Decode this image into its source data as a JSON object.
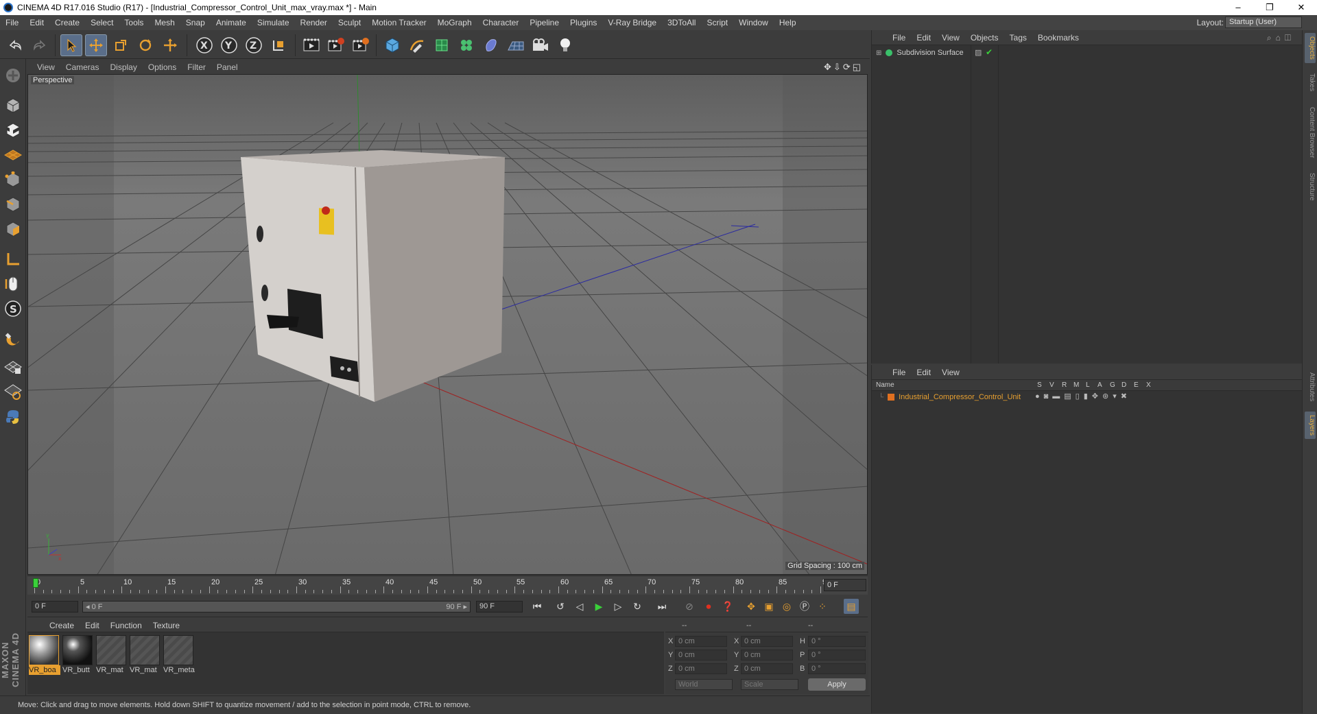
{
  "window": {
    "title": "CINEMA 4D R17.016 Studio (R17) - [Industrial_Compressor_Control_Unit_max_vray.max *] - Main",
    "controls": [
      "–",
      "❐",
      "✕"
    ]
  },
  "menu": {
    "items": [
      "File",
      "Edit",
      "Create",
      "Select",
      "Tools",
      "Mesh",
      "Snap",
      "Animate",
      "Simulate",
      "Render",
      "Sculpt",
      "Motion Tracker",
      "MoGraph",
      "Character",
      "Pipeline",
      "Plugins",
      "V-Ray Bridge",
      "3DToAll",
      "Script",
      "Window",
      "Help"
    ],
    "layout_label": "Layout:",
    "layout_value": "Startup (User)"
  },
  "viewport": {
    "menu": [
      "View",
      "Cameras",
      "Display",
      "Options",
      "Filter",
      "Panel"
    ],
    "camera": "Perspective",
    "grid_spacing": "Grid Spacing : 100 cm"
  },
  "timeline": {
    "ticks": [
      "0",
      "5",
      "10",
      "15",
      "20",
      "25",
      "30",
      "35",
      "40",
      "45",
      "50",
      "55",
      "60",
      "65",
      "70",
      "75",
      "80",
      "85",
      "90"
    ],
    "end_frame": "0 F",
    "start_field": "0 F",
    "range_start": "◂ 0 F",
    "range_end": "90 F ▸",
    "max_field": "90 F"
  },
  "materials": {
    "menu": [
      "Create",
      "Edit",
      "Function",
      "Texture"
    ],
    "items": [
      {
        "name": "VR_boa",
        "selected": true
      },
      {
        "name": "VR_butt",
        "selected": false
      },
      {
        "name": "VR_mat",
        "selected": false
      },
      {
        "name": "VR_mat",
        "selected": false
      },
      {
        "name": "VR_meta",
        "selected": false
      }
    ]
  },
  "coords": {
    "header": [
      "--",
      "--",
      "--"
    ],
    "rows": [
      {
        "a": "X",
        "av": "0 cm",
        "b": "X",
        "bv": "0 cm",
        "c": "H",
        "cv": "0 °"
      },
      {
        "a": "Y",
        "av": "0 cm",
        "b": "Y",
        "bv": "0 cm",
        "c": "P",
        "cv": "0 °"
      },
      {
        "a": "Z",
        "av": "0 cm",
        "b": "Z",
        "bv": "0 cm",
        "c": "B",
        "cv": "0 °"
      }
    ],
    "mode": "World",
    "scale": "Scale",
    "apply": "Apply"
  },
  "objects": {
    "menu": [
      "File",
      "Edit",
      "View",
      "Objects",
      "Tags",
      "Bookmarks"
    ],
    "items": [
      {
        "name": "Subdivision Surface"
      }
    ]
  },
  "layers": {
    "menu": [
      "File",
      "Edit",
      "View"
    ],
    "col_name": "Name",
    "cols": [
      "S",
      "V",
      "R",
      "M",
      "L",
      "A",
      "G",
      "D",
      "E",
      "X"
    ],
    "items": [
      {
        "name": "Industrial_Compressor_Control_Unit",
        "color": "#e07020"
      }
    ]
  },
  "sidetabs": [
    "Objects",
    "Takes",
    "Content Browser",
    "Structure",
    "Attributes",
    "Layers"
  ],
  "brand": "MAXON CINEMA 4D",
  "status": "Move: Click and drag to move elements. Hold down SHIFT to quantize movement / add to the selection in point mode, CTRL to remove.",
  "colors": {
    "accent": "#e8a030",
    "selection": "#5a6e8a",
    "viewport_bg": "#6b6b6b"
  }
}
